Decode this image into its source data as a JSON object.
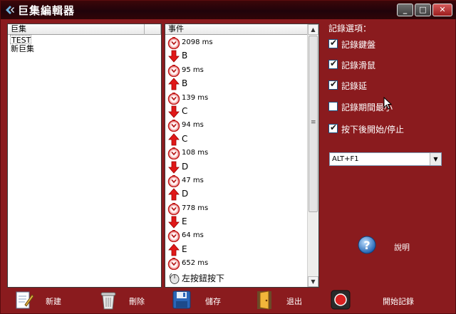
{
  "window": {
    "title": "巨集編輯器"
  },
  "macro_panel": {
    "header": "巨集",
    "items": [
      {
        "label": "TEST",
        "selected": true
      },
      {
        "label": "新巨集",
        "selected": false
      }
    ]
  },
  "event_panel": {
    "header": "事件",
    "events": [
      {
        "icon": "timer-icon",
        "text": "2098 ms"
      },
      {
        "icon": "arrow-down-icon",
        "text": "B"
      },
      {
        "icon": "timer-icon",
        "text": "95 ms"
      },
      {
        "icon": "arrow-up-icon",
        "text": "B"
      },
      {
        "icon": "timer-icon",
        "text": "139 ms"
      },
      {
        "icon": "arrow-down-icon",
        "text": "C"
      },
      {
        "icon": "timer-icon",
        "text": "94 ms"
      },
      {
        "icon": "arrow-up-icon",
        "text": "C"
      },
      {
        "icon": "timer-icon",
        "text": "108 ms"
      },
      {
        "icon": "arrow-down-icon",
        "text": "D"
      },
      {
        "icon": "timer-icon",
        "text": "47 ms"
      },
      {
        "icon": "arrow-up-icon",
        "text": "D"
      },
      {
        "icon": "timer-icon",
        "text": "778 ms"
      },
      {
        "icon": "arrow-down-icon",
        "text": "E"
      },
      {
        "icon": "timer-icon",
        "text": "64 ms"
      },
      {
        "icon": "arrow-up-icon",
        "text": "E"
      },
      {
        "icon": "timer-icon",
        "text": "652 ms"
      },
      {
        "icon": "mouse-icon",
        "text": "左按鈕按下"
      }
    ]
  },
  "options": {
    "title": "記錄選項：",
    "items": [
      {
        "label": "記錄鍵盤",
        "checked": true
      },
      {
        "label": "記錄滑鼠",
        "checked": true
      },
      {
        "label": "記錄延",
        "checked": true
      },
      {
        "label": "記錄期間最小",
        "checked": false
      },
      {
        "label": "按下後開始/停止",
        "checked": true
      }
    ],
    "hotkey": "ALT+F1"
  },
  "help": {
    "label": "說明"
  },
  "toolbar": {
    "new_label": "新建",
    "delete_label": "刪除",
    "save_label": "儲存",
    "exit_label": "退出",
    "record_label": "開始記錄"
  },
  "colors": {
    "background": "#8a1b1e",
    "titlebar": "#20030a",
    "text_light": "#ffffff"
  }
}
